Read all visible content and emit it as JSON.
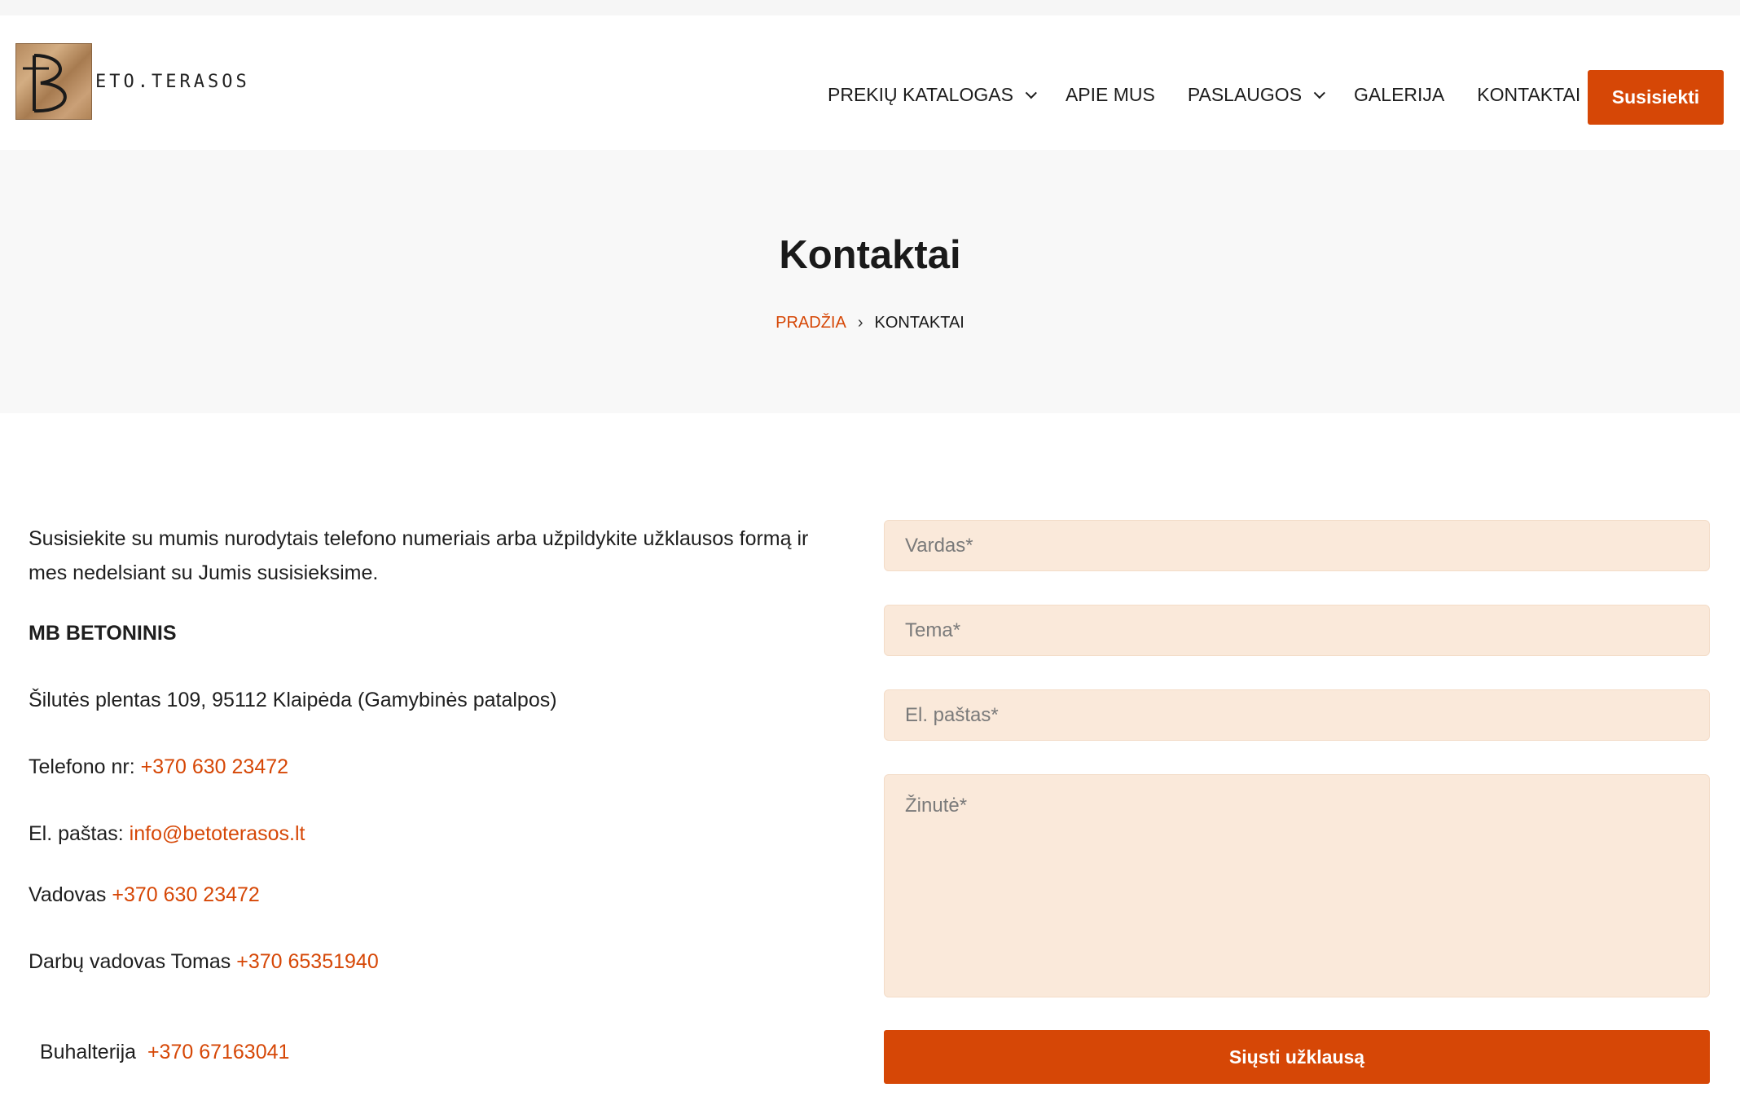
{
  "brand": {
    "logo_letter": "B",
    "logo_text": "ETO.TERASOS"
  },
  "nav": {
    "items": [
      {
        "label": "PREKIŲ KATALOGAS",
        "dropdown": true
      },
      {
        "label": "APIE MUS",
        "dropdown": false
      },
      {
        "label": "PASLAUGOS",
        "dropdown": true
      },
      {
        "label": "GALERIJA",
        "dropdown": false
      },
      {
        "label": "KONTAKTAI",
        "dropdown": false
      }
    ],
    "cta_label": "Susisiekti"
  },
  "hero": {
    "title": "Kontaktai",
    "breadcrumb_home": "PRADŽIA",
    "breadcrumb_separator": "›",
    "breadcrumb_current": "KONTAKTAI"
  },
  "contact": {
    "intro": "Susisiekite su mumis nurodytais telefono numeriais arba užpildykite užklausos formą ir mes nedelsiant su Jumis susisieksime.",
    "company": "MB BETONINIS",
    "address": "Šilutės plentas 109, 95112 Klaipėda (Gamybinės patalpos)",
    "phone_label": "Telefono nr: ",
    "phone": "+370 630 23472",
    "email_label": "El. paštas: ",
    "email": "info@betoterasos.lt",
    "manager_label": "Vadovas ",
    "manager_phone": "+370 630 23472",
    "works_manager_label": "Darbų vadovas Tomas ",
    "works_manager_phone": "+370 65351940",
    "accounting_label": "Buhalterija  ",
    "accounting_phone": "+370 67163041"
  },
  "form": {
    "name_placeholder": "Vardas*",
    "subject_placeholder": "Tema*",
    "email_placeholder": "El. paštas*",
    "message_placeholder": "Žinutė*",
    "submit_label": "Siųsti užklausą"
  },
  "colors": {
    "accent": "#d64706",
    "field_bg": "#fae9da",
    "hero_bg": "#f8f8f8"
  }
}
